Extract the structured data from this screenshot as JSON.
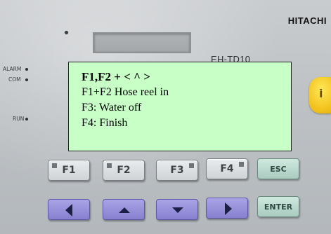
{
  "device": {
    "brand": "HITACHI",
    "model": "EH-TD10",
    "leds": [
      {
        "label": "ALARM"
      },
      {
        "label": "COM"
      },
      {
        "label": "RUN"
      }
    ],
    "info_key_label": "i"
  },
  "tooltip": {
    "title": "F1,F2 + < ^ >",
    "lines": [
      "F1+F2 Hose reel in",
      "F3: Water off",
      "F4: Finish"
    ],
    "background_color": "#c7ffc7"
  },
  "keys": {
    "function": [
      {
        "label": "F1"
      },
      {
        "label": "F2"
      },
      {
        "label": "F3"
      },
      {
        "label": "F4"
      }
    ],
    "esc_label": "ESC",
    "enter_label": "ENTER",
    "arrows": [
      {
        "icon": "arrow-left-icon"
      },
      {
        "icon": "arrow-up-icon"
      },
      {
        "icon": "arrow-down-icon"
      },
      {
        "icon": "arrow-right-icon"
      }
    ]
  },
  "colors": {
    "arrow_keys": "#8f88d8",
    "esc_enter_keys": "#bcdcd0",
    "info_key": "#f2c21c"
  }
}
